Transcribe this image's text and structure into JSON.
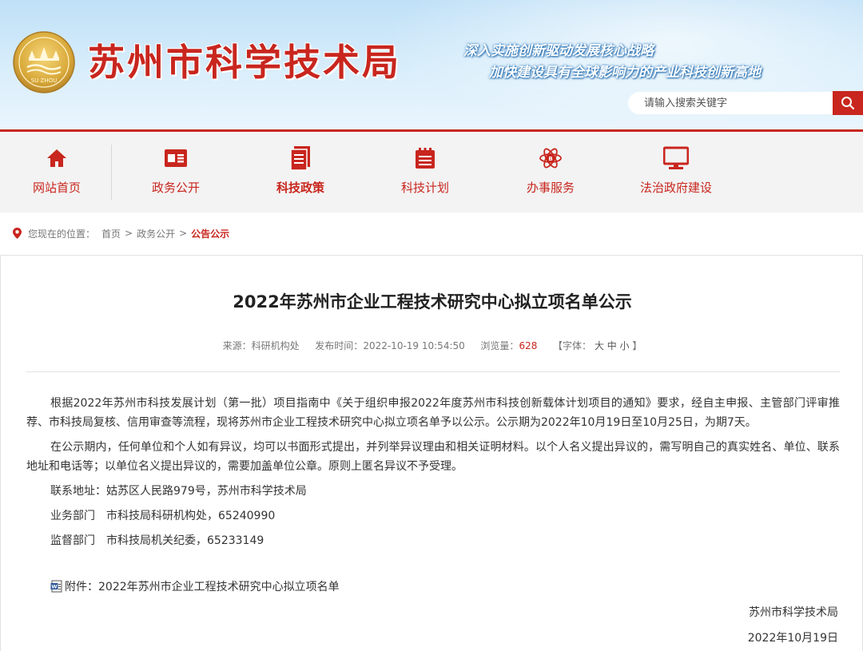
{
  "header": {
    "site_title": "苏州市科学技术局",
    "logo_text": "SU ZHOU",
    "slogan_line1": "深入实施创新驱动发展核心战略",
    "slogan_line2": "加快建设具有全球影响力的产业科技创新高地",
    "search_placeholder": "请输入搜索关键字",
    "accent_color": "#c8261e"
  },
  "nav": {
    "items": [
      {
        "label": "网站首页",
        "icon": "home-icon"
      },
      {
        "label": "政务公开",
        "icon": "id-card-icon"
      },
      {
        "label": "科技政策",
        "icon": "document-stack-icon",
        "active": true
      },
      {
        "label": "科技计划",
        "icon": "calendar-list-icon"
      },
      {
        "label": "办事服务",
        "icon": "atom-icon"
      },
      {
        "label": "法治政府建设",
        "icon": "monitor-icon"
      }
    ]
  },
  "breadcrumb": {
    "prefix": "您现在的位置：",
    "items": [
      "首页",
      "政务公开"
    ],
    "current": "公告公示",
    "separator": ">"
  },
  "article": {
    "title": "2022年苏州市企业工程技术研究中心拟立项名单公示",
    "meta": {
      "source_label": "来源：",
      "source": "科研机构处",
      "published_label": "发布时间：",
      "published": "2022-10-19 10:54:50",
      "views_label": "浏览量：",
      "views": "628",
      "font_label": "【字体：",
      "font_large": "大",
      "font_medium": "中",
      "font_small": "小",
      "font_close": "】"
    },
    "paragraphs": [
      "根据2022年苏州市科技发展计划（第一批）项目指南中《关于组织申报2022年度苏州市科技创新载体计划项目的通知》要求，经自主申报、主管部门评审推荐、市科技局复核、信用审查等流程，现将苏州市企业工程技术研究中心拟立项名单予以公示。公示期为2022年10月19日至10月25日，为期7天。",
      "在公示期内，任何单位和个人如有异议，均可以书面形式提出，并列举异议理由和相关证明材料。以个人名义提出异议的，需写明自己的真实姓名、单位、联系地址和电话等；以单位名义提出异议的，需要加盖单位公章。原则上匿名异议不予受理。",
      "联系地址：姑苏区人民路979号，苏州市科学技术局",
      "业务部门　市科技局科研机构处，65240990",
      "监督部门　市科技局机关纪委，65233149"
    ],
    "attachment": "附件：2022年苏州市企业工程技术研究中心拟立项名单",
    "signature": "苏州市科学技术局",
    "date": "2022年10月19日"
  }
}
